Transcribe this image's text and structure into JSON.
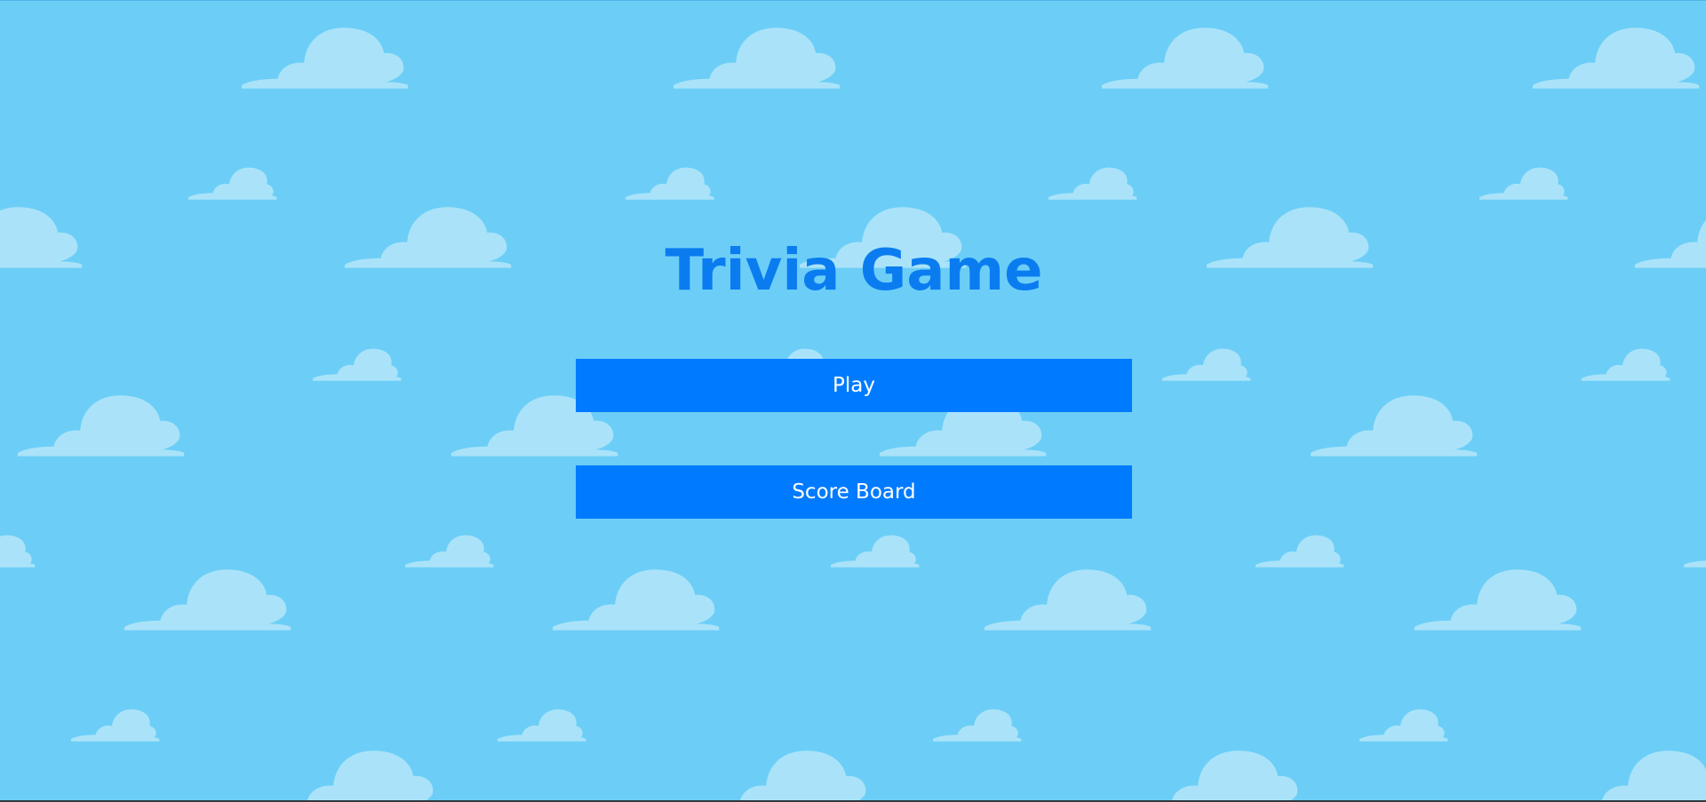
{
  "page": {
    "title": "Trivia Game",
    "background_color": "#6ccef7",
    "cloud_color": "#aae3f9",
    "accent_color": "#007bff",
    "title_color": "#0a7cf0"
  },
  "menu": {
    "play_label": "Play",
    "scoreboard_label": "Score Board"
  },
  "background": {
    "pattern": "cloud-pattern"
  }
}
